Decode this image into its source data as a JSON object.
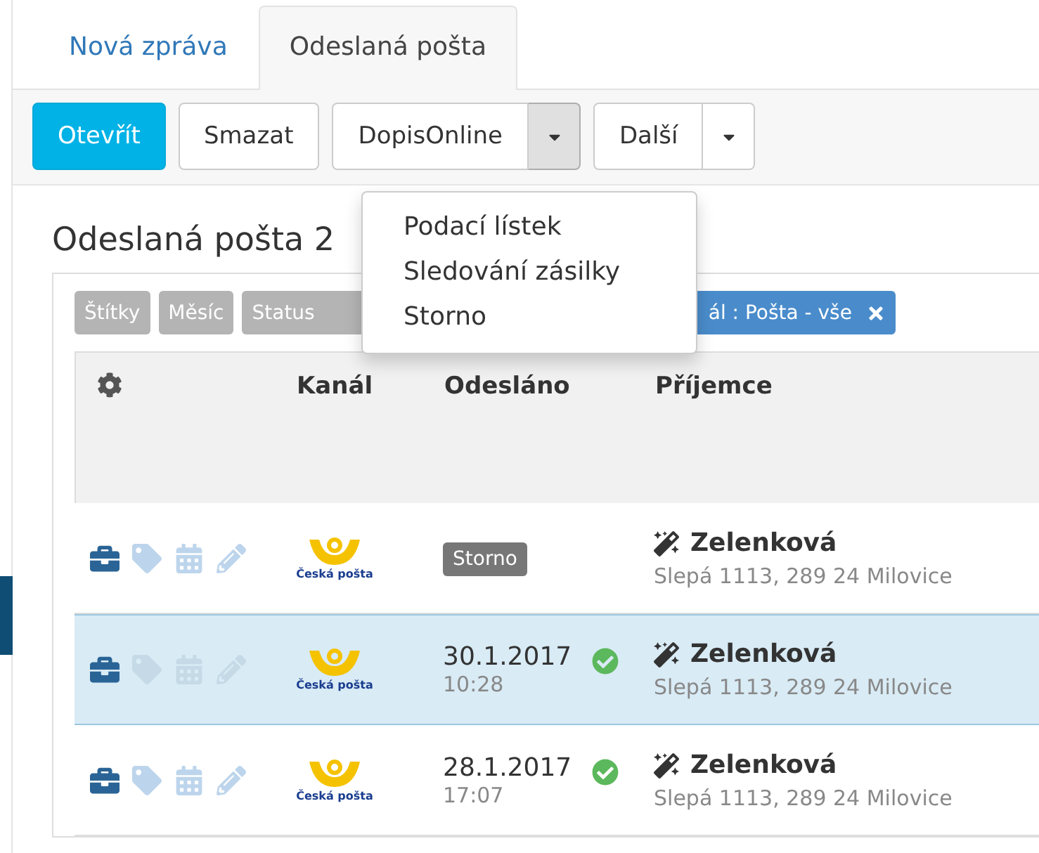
{
  "tabs": [
    {
      "label": "Nová zpráva",
      "selected": false
    },
    {
      "label": "Odeslaná pošta",
      "selected": true
    }
  ],
  "toolbar": {
    "open": "Otevřít",
    "delete": "Smazat",
    "split": "DopisOnline",
    "more": "Další"
  },
  "menu": {
    "expanded": true,
    "items": [
      "Podací lístek",
      "Sledování zásilky",
      "Storno"
    ]
  },
  "heading": "Odeslaná pošta 2",
  "filters": [
    {
      "label": "Štítky",
      "kind": "plain"
    },
    {
      "label": "Měsíc",
      "kind": "plain"
    },
    {
      "label": "Status",
      "kind": "plain"
    },
    {
      "label": "ál : Pošta - vše",
      "kind": "active"
    }
  ],
  "columns": [
    "Kanál",
    "Odesláno",
    "Příjemce"
  ],
  "rows": [
    {
      "selected": false,
      "channel": "Česká pošta",
      "status": "Storno",
      "date": null,
      "time": null,
      "delivered": false,
      "name": "Zelenková",
      "address": "Slepá 1113, 289 24 Milovice"
    },
    {
      "selected": true,
      "channel": "Česká pošta",
      "status": null,
      "date": "30.1.2017",
      "time": "10:28",
      "delivered": true,
      "name": "Zelenková",
      "address": "Slepá 1113, 289 24 Milovice"
    },
    {
      "selected": false,
      "channel": "Česká pošta",
      "status": null,
      "date": "28.1.2017",
      "time": "17:07",
      "delivered": true,
      "name": "Zelenková",
      "address": "Slepá 1113, 289 24 Milovice"
    }
  ]
}
